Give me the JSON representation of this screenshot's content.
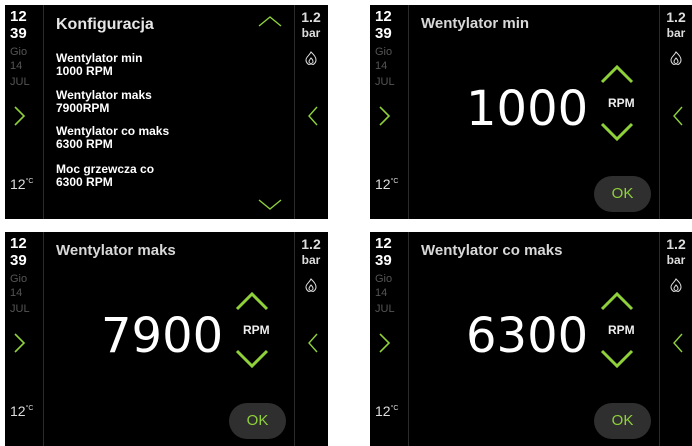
{
  "status": {
    "hour": "12",
    "minute": "39",
    "day_name": "Gio",
    "day": "14",
    "month": "JUL",
    "temperature": "12",
    "temperature_unit": "°C",
    "pressure": "1.2",
    "pressure_unit": "bar"
  },
  "accent_color": "#8fd13b",
  "icons": [
    "chevron-right-icon",
    "chevron-left-icon",
    "flame-icon",
    "chevron-up-icon",
    "chevron-down-icon"
  ],
  "menu": {
    "title": "Konfiguracja",
    "items": [
      {
        "label": "Wentylator min",
        "value": "1000 RPM"
      },
      {
        "label": "Wentylator maks",
        "value": "7900RPM"
      },
      {
        "label": "Wentylator co maks",
        "value": "6300 RPM"
      },
      {
        "label": "Moc grzewcza co",
        "value": "6300 RPM"
      }
    ]
  },
  "screens": [
    {
      "title": "Wentylator min",
      "value": "1000",
      "unit": "RPM",
      "ok": "OK"
    },
    {
      "title": "Wentylator maks",
      "value": "7900",
      "unit": "RPM",
      "ok": "OK"
    },
    {
      "title": "Wentylator co maks",
      "value": "6300",
      "unit": "RPM",
      "ok": "OK"
    }
  ]
}
